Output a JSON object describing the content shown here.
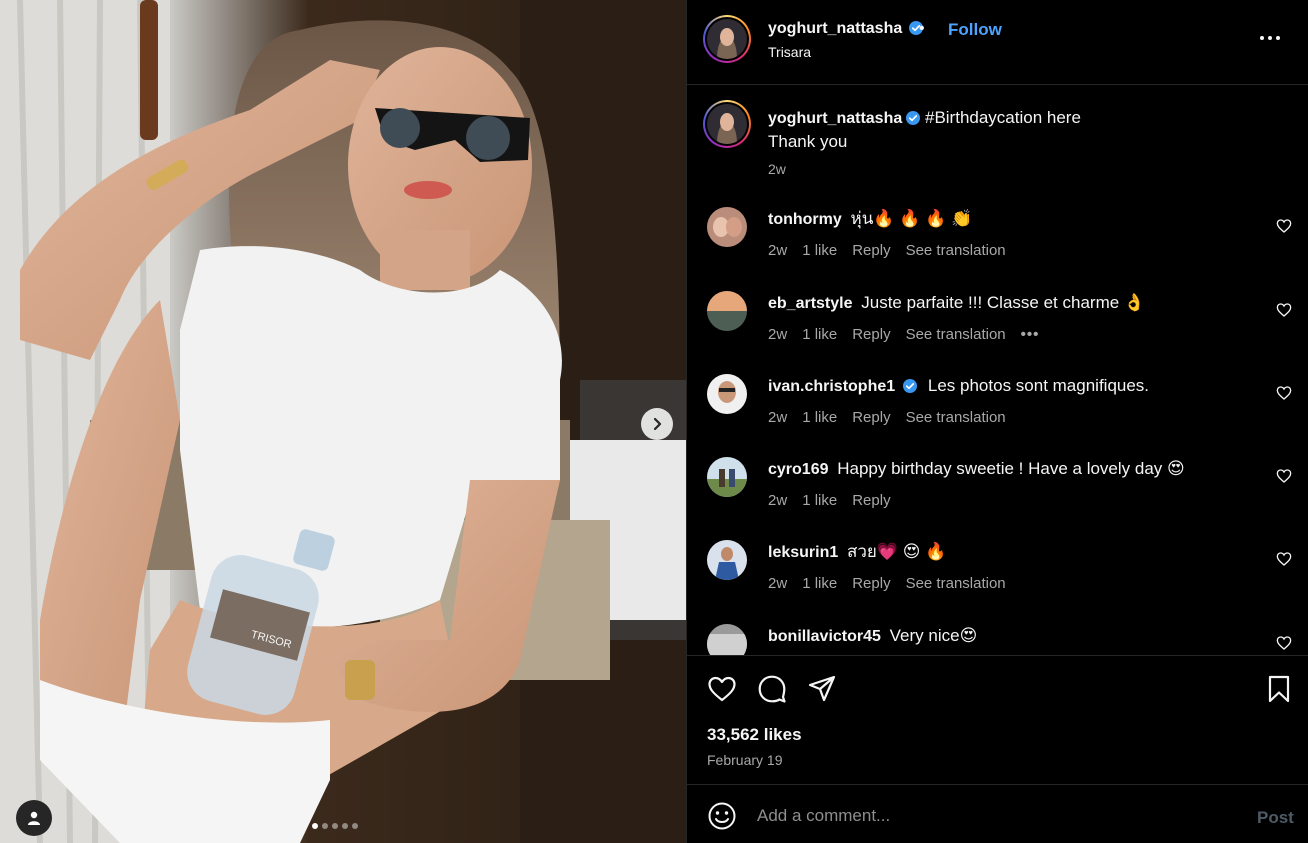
{
  "post": {
    "author": {
      "username": "yoghurt_nattasha",
      "verified": true,
      "location": "Trisara",
      "follow_label": "Follow",
      "separator": "•"
    },
    "media": {
      "bottle_label": "TRISOR",
      "slides": 5,
      "active_slide": 1
    },
    "caption": {
      "username": "yoghurt_nattasha",
      "text_line1": "#Birthdaycation here",
      "text_line2": "Thank you",
      "time": "2w"
    },
    "comments": [
      {
        "username": "tonhormy",
        "text": "หุ่น🔥 🔥 🔥 👏",
        "time": "2w",
        "likes": "1 like",
        "reply": "Reply",
        "translate": "See translation",
        "more": ""
      },
      {
        "username": "eb_artstyle",
        "text": "Juste parfaite !!! Classe et charme 👌",
        "time": "2w",
        "likes": "1 like",
        "reply": "Reply",
        "translate": "See translation",
        "more": "•••"
      },
      {
        "username": "ivan.christophe1",
        "verified": true,
        "text": "Les photos sont magnifiques.",
        "time": "2w",
        "likes": "1 like",
        "reply": "Reply",
        "translate": "See translation",
        "more": ""
      },
      {
        "username": "cyro169",
        "text": "Happy birthday sweetie ! Have a lovely day 😍",
        "time": "2w",
        "likes": "1 like",
        "reply": "Reply",
        "translate": "",
        "more": ""
      },
      {
        "username": "leksurin1",
        "text": "สวย💗 😍 🔥",
        "time": "2w",
        "likes": "1 like",
        "reply": "Reply",
        "translate": "See translation",
        "more": ""
      },
      {
        "username": "bonillavictor45",
        "text": "Very nice😍",
        "time": "",
        "likes": "",
        "reply": "",
        "translate": "",
        "more": ""
      }
    ],
    "stats": {
      "likes": "33,562 likes",
      "date": "February 19"
    },
    "composer": {
      "placeholder": "Add a comment...",
      "post_label": "Post"
    }
  },
  "colors": {
    "background": "#000000",
    "text": "#f5f5f5",
    "secondary": "#a8a8a8",
    "link": "#4da3ff",
    "verified": "#3897f0",
    "border": "#262626"
  }
}
